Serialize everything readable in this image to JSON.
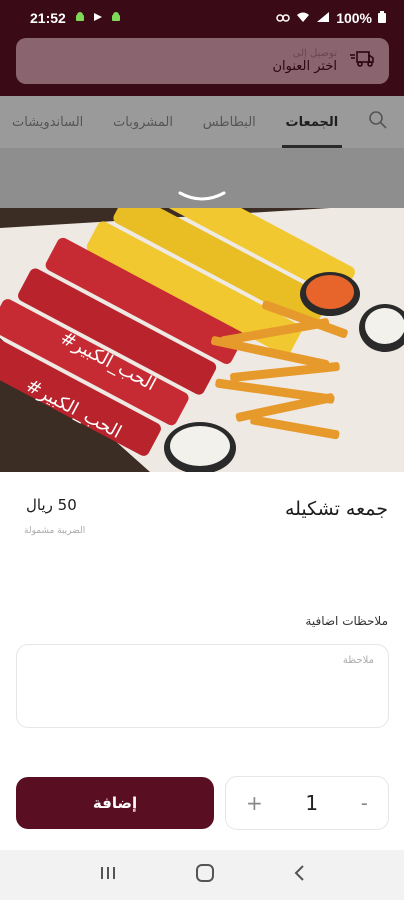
{
  "status": {
    "time": "21:52",
    "battery": "100%"
  },
  "header": {
    "delivery_small": "توصيل إلى",
    "delivery_address": "اختر العنوان"
  },
  "tabs": [
    {
      "label": "الجمعات"
    },
    {
      "label": "البطاطس"
    },
    {
      "label": "المشروبات"
    },
    {
      "label": "الساندويشات"
    }
  ],
  "product": {
    "title": "جمعه تشكيله",
    "price": "50 ريال",
    "tax_note": "الضريبة مشمولة",
    "image_text_a": "#الحب_الكبير",
    "image_text_b": "#الحب_الكبير"
  },
  "notes": {
    "label": "ملاحظات اضافية",
    "placeholder": "ملاحظة"
  },
  "actions": {
    "add_label": "إضافة",
    "quantity": "1",
    "plus": "+",
    "minus": "-"
  },
  "colors": {
    "brand": "#5a0e22",
    "header": "#3a0a17"
  }
}
